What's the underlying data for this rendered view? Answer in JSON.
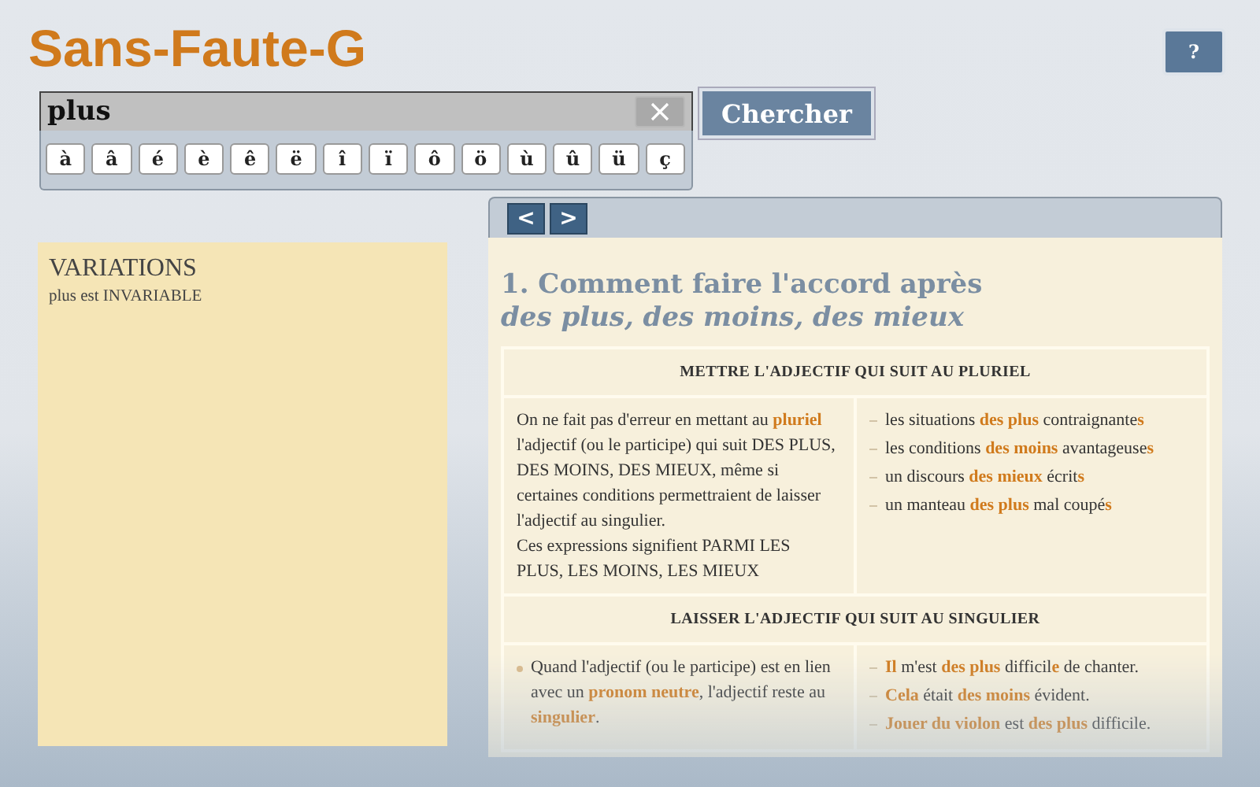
{
  "app_title": "Sans-Faute-G",
  "help_button": "?",
  "search": {
    "value": "plus"
  },
  "search_button": "Chercher",
  "accent_keys": [
    "à",
    "â",
    "é",
    "è",
    "ê",
    "ë",
    "î",
    "ï",
    "ô",
    "ö",
    "ù",
    "û",
    "ü",
    "ç"
  ],
  "variations": {
    "title": "VARIATIONS",
    "text": "plus est INVARIABLE"
  },
  "nav": {
    "prev": "<",
    "next": ">"
  },
  "article": {
    "title": "1. Comment faire l'accord après",
    "subtitle": "des plus, des moins, des mieux",
    "sections": [
      {
        "heading": "METTRE L'ADJECTIF QUI SUIT AU PLURIEL",
        "explanation": [
          {
            "kind": "paragraph",
            "text": "On ne fait pas d'erreur en mettant au **pluriel** l'adjectif (ou le participe) qui suit DES PLUS, DES MOINS, DES MIEUX, même si certaines conditions permettraient de laisser l'adjectif au singulier."
          },
          {
            "kind": "paragraph",
            "text": "Ces expressions signifient PARMI LES PLUS, LES MOINS, LES MIEUX"
          }
        ],
        "examples": [
          "les situations **des plus** contraignante**s**",
          "les conditions **des moins** avantageuse**s**",
          "un discours **des mieux** écrit**s**",
          "un manteau **des plus** mal coupé**s**"
        ]
      },
      {
        "heading": "LAISSER L'ADJECTIF QUI SUIT AU SINGULIER",
        "explanation": [
          {
            "kind": "bullet",
            "text": "Quand l'adjectif (ou le participe) est en lien avec un **pronom neutre**, l'adjectif reste au **singulier**."
          }
        ],
        "examples": [
          "**Il** m'est **des plus** difficil**e** de chanter.",
          "**Cela** était **des moins** évident.",
          "**Jouer du violon** est **des plus** difficile."
        ]
      }
    ]
  }
}
